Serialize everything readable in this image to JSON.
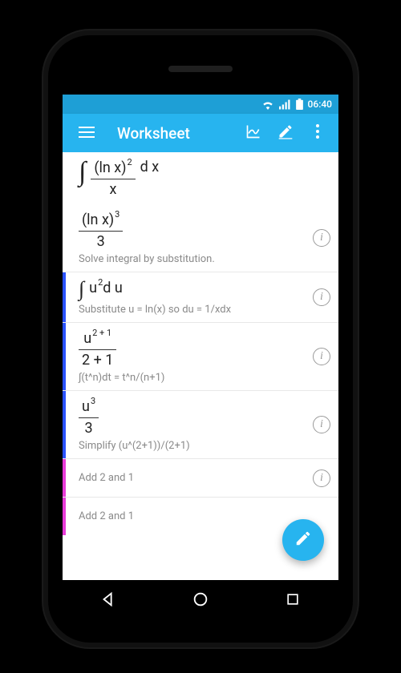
{
  "status": {
    "time": "06:40"
  },
  "appbar": {
    "title": "Worksheet"
  },
  "colors": {
    "brand": "#27b4ef",
    "status": "#1e9fd6",
    "step_blue": "#2a52ff",
    "step_magenta": "#e83bd8"
  },
  "rows": [
    {
      "kind": "integral",
      "num_base": "(ln x)",
      "num_exp": "2",
      "den": "x",
      "dx": "d x"
    },
    {
      "kind": "fraction",
      "num_base": "(ln x)",
      "num_exp": "3",
      "den": "3",
      "caption": "Solve integral by substitution."
    },
    {
      "kind": "integral-flat",
      "base": "u",
      "exp": "2",
      "tail": "d u",
      "caption": "Substitute u = ln(x) so du = 1/xdx",
      "accent": "blue"
    },
    {
      "kind": "fraction",
      "num_base": "u",
      "num_exp": "2 + 1",
      "den": "2 + 1",
      "caption": "∫(t^n)dt = t^n/(n+1)",
      "accent": "blue"
    },
    {
      "kind": "fraction",
      "num_base": "u",
      "num_exp": "3",
      "den": "3",
      "caption": "Simplify (u^(2+1))/(2+1)",
      "accent": "blue"
    },
    {
      "kind": "note",
      "caption": "Add 2 and 1",
      "accent": "magenta"
    },
    {
      "kind": "note",
      "caption": "Add 2 and 1",
      "accent": "magenta"
    }
  ]
}
